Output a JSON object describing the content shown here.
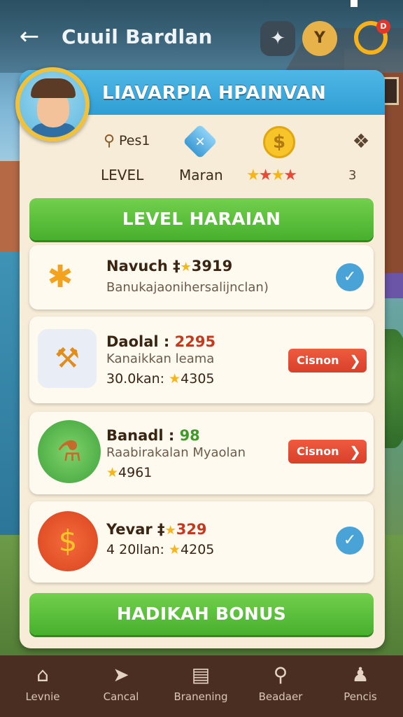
{
  "header": {
    "back_icon": "arrow-left-icon",
    "title": "Cuuil Bardlan",
    "user_initial": "Y",
    "notif_badge": "D"
  },
  "card": {
    "title": "LIAVARPIA HPAINVAN",
    "stats": {
      "pes_label": "Pes1",
      "level_label": "LEVEL",
      "map_label": "Maran",
      "rating_stars": 4,
      "extra_value": "3"
    },
    "level_button": "LEVEL HARAIAN",
    "bonus_button": "HADIKAH BONUS"
  },
  "rows": [
    {
      "title": "Navuch",
      "title_value": "3919",
      "subtitle": "Banukajaonihersalijnclan)",
      "status": "completed"
    },
    {
      "title": "Daolal",
      "title_value": "2295",
      "subtitle": "Kanaikkan leama",
      "meta_label": "30.0kan:",
      "meta_value": "4305",
      "action": "Cisnon"
    },
    {
      "title": "Banadl",
      "title_value": "98",
      "subtitle": "Raabirakalan Myaolan",
      "meta_value": "4961",
      "action": "Cisnon"
    },
    {
      "title": "Yevar",
      "title_value": "329",
      "meta_label": "4 20llan:",
      "meta_value": "4205",
      "status": "completed"
    }
  ],
  "nav": [
    {
      "label": "Levnie",
      "icon": "home-icon"
    },
    {
      "label": "Cancal",
      "icon": "send-icon"
    },
    {
      "label": "Branening",
      "icon": "list-icon"
    },
    {
      "label": "Beadaer",
      "icon": "search-icon"
    },
    {
      "label": "Pencis",
      "icon": "users-icon"
    }
  ],
  "colors": {
    "header_blue": "#2f9ed4",
    "button_green": "#47b02d",
    "chip_red": "#d8402a",
    "check_blue": "#4aa3d6",
    "nav_brown": "#4a2e22"
  }
}
